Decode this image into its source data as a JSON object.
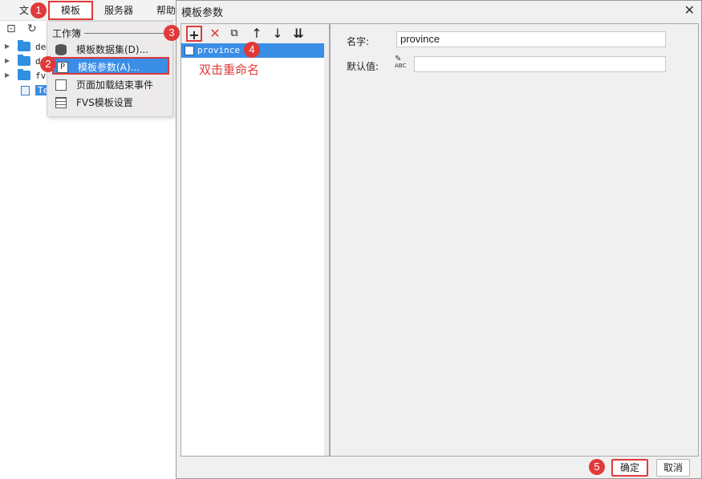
{
  "menubar": {
    "items": [
      "文",
      "模板",
      "服务器",
      "帮助"
    ]
  },
  "tree": {
    "items": [
      "dem",
      "de",
      "fvs",
      "Tem"
    ]
  },
  "dropdown": {
    "header": "工作簿",
    "items": [
      "模板数据集(D)...",
      "模板参数(A)...",
      "页面加载结束事件",
      "FVS模板设置"
    ]
  },
  "dialog": {
    "title": "模板参数",
    "close": "✕",
    "toolbar_icons": [
      "add-icon",
      "delete-icon",
      "copy-icon",
      "move-up-icon",
      "move-down-icon",
      "sort-icon"
    ],
    "params": [
      "province"
    ],
    "hint": "双击重命名",
    "name_label": "名字:",
    "name_value": "province",
    "default_label": "默认值:",
    "default_value": "",
    "type_icon_text": "ABC",
    "ok_label": "确定",
    "cancel_label": "取消"
  },
  "badges": [
    "1",
    "2",
    "3",
    "4",
    "5"
  ],
  "colors": {
    "accent": "#3a8ee6",
    "highlight": "#e03a3a"
  }
}
